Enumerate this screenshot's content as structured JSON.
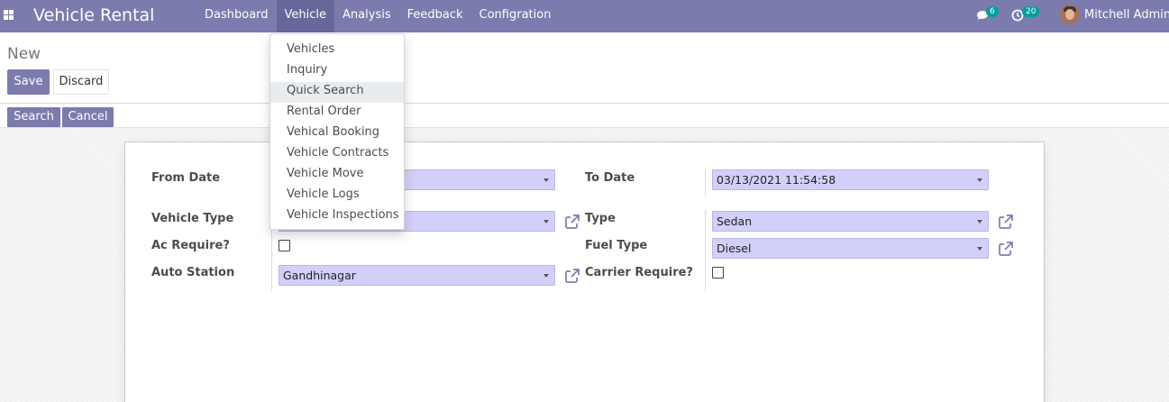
{
  "navbar": {
    "brand": "Vehicle Rental",
    "menu": [
      {
        "label": "Dashboard",
        "active": false
      },
      {
        "label": "Vehicle",
        "active": true
      },
      {
        "label": "Analysis",
        "active": false
      },
      {
        "label": "Feedback",
        "active": false
      },
      {
        "label": "Configration",
        "active": false
      }
    ],
    "messages_count": "6",
    "activities_count": "20",
    "user_name": "Mitchell Admin"
  },
  "breadcrumb": "New",
  "actions": {
    "save": "Save",
    "discard": "Discard"
  },
  "statusbar": {
    "search": "Search",
    "cancel": "Cancel"
  },
  "form": {
    "from_date": {
      "label": "From Date",
      "value": ""
    },
    "to_date": {
      "label": "To Date",
      "value": "03/13/2021 11:54:58"
    },
    "vehicle_type": {
      "label": "Vehicle Type",
      "value": ""
    },
    "type": {
      "label": "Type",
      "value": "Sedan"
    },
    "ac_require": {
      "label": "Ac Require?",
      "checked": false
    },
    "fuel_type": {
      "label": "Fuel Type",
      "value": "Diesel"
    },
    "auto_station": {
      "label": "Auto Station",
      "value": "Gandhinagar"
    },
    "carrier_require": {
      "label": "Carrier Require?",
      "checked": false
    }
  },
  "vehicle_menu": {
    "items": [
      "Vehicles",
      "Inquiry",
      "Quick Search",
      "Rental Order",
      "Vehical Booking",
      "Vehicle Contracts",
      "Vehicle Move",
      "Vehicle Logs",
      "Vehicle Inspections"
    ],
    "highlighted": "Quick Search"
  },
  "colors": {
    "navbar": "#7c7bad",
    "active_menu": "#68679a",
    "field_bg": "#d2d0fb",
    "badge": "#00a09d"
  }
}
